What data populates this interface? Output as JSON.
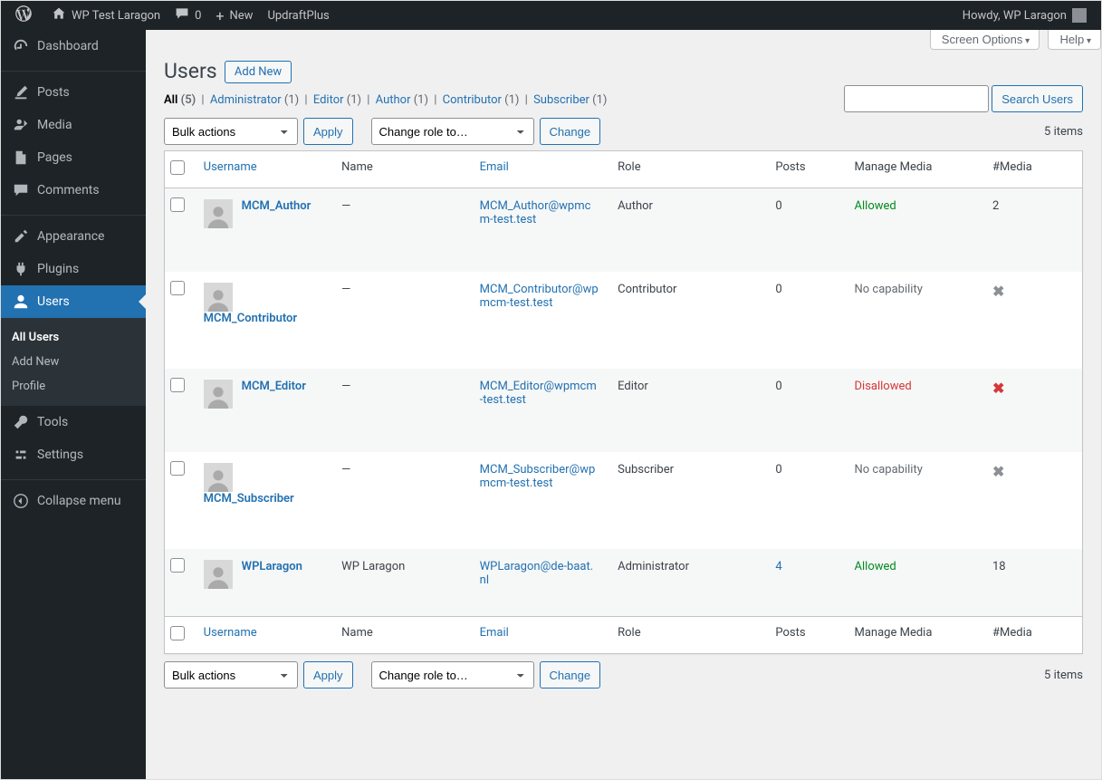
{
  "adminbar": {
    "site_name": "WP Test Laragon",
    "comments": "0",
    "new": "New",
    "updraft": "UpdraftPlus",
    "howdy": "Howdy, WP Laragon"
  },
  "sidebar": [
    {
      "icon": "dashboard",
      "label": "Dashboard"
    },
    {
      "sep": true
    },
    {
      "icon": "posts",
      "label": "Posts"
    },
    {
      "icon": "media",
      "label": "Media"
    },
    {
      "icon": "pages",
      "label": "Pages"
    },
    {
      "icon": "comments",
      "label": "Comments"
    },
    {
      "sep": true
    },
    {
      "icon": "appearance",
      "label": "Appearance"
    },
    {
      "icon": "plugins",
      "label": "Plugins"
    },
    {
      "icon": "users",
      "label": "Users",
      "current": true,
      "submenu": [
        {
          "label": "All Users",
          "current": true
        },
        {
          "label": "Add New"
        },
        {
          "label": "Profile"
        }
      ]
    },
    {
      "icon": "tools",
      "label": "Tools"
    },
    {
      "icon": "settings",
      "label": "Settings"
    },
    {
      "sep": true
    },
    {
      "icon": "collapse",
      "label": "Collapse menu"
    }
  ],
  "screen_links": {
    "screen_options": "Screen Options",
    "help": "Help"
  },
  "heading": "Users",
  "add_new": "Add New",
  "filters": [
    {
      "label": "All",
      "count": "(5)",
      "current": true
    },
    {
      "label": "Administrator",
      "count": "(1)"
    },
    {
      "label": "Editor",
      "count": "(1)"
    },
    {
      "label": "Author",
      "count": "(1)"
    },
    {
      "label": "Contributor",
      "count": "(1)"
    },
    {
      "label": "Subscriber",
      "count": "(1)"
    }
  ],
  "search_button": "Search Users",
  "bulk_label": "Bulk actions",
  "apply": "Apply",
  "change_role_label": "Change role to…",
  "change": "Change",
  "item_count": "5 items",
  "columns": {
    "username": "Username",
    "name": "Name",
    "email": "Email",
    "role": "Role",
    "posts": "Posts",
    "manage": "Manage Media",
    "media": "#Media"
  },
  "rows": [
    {
      "username": "MCM_Author",
      "name": "—",
      "email": "MCM_Author@wpmcm-test.test",
      "role": "Author",
      "posts": "0",
      "posts_link": false,
      "manage": "Allowed",
      "manage_cls": "allowed",
      "media": "2",
      "media_icon": ""
    },
    {
      "username": "MCM_Contributor",
      "username_below": true,
      "name": "—",
      "email": "MCM_Contributor@wpmcm-test.test",
      "role": "Contributor",
      "posts": "0",
      "posts_link": false,
      "manage": "No capability",
      "manage_cls": "nocap",
      "media": "",
      "media_icon": "gray"
    },
    {
      "username": "MCM_Editor",
      "name": "—",
      "email": "MCM_Editor@wpmcm-test.test",
      "role": "Editor",
      "posts": "0",
      "posts_link": false,
      "manage": "Disallowed",
      "manage_cls": "disallowed",
      "media": "",
      "media_icon": "red"
    },
    {
      "username": "MCM_Subscriber",
      "username_below": true,
      "name": "—",
      "email": "MCM_Subscriber@wpmcm-test.test",
      "role": "Subscriber",
      "posts": "0",
      "posts_link": false,
      "manage": "No capability",
      "manage_cls": "nocap",
      "media": "",
      "media_icon": "gray"
    },
    {
      "username": "WPLaragon",
      "name": "WP Laragon",
      "email": "WPLaragon@de-baat.nl",
      "role": "Administrator",
      "posts": "4",
      "posts_link": true,
      "manage": "Allowed",
      "manage_cls": "allowed",
      "media": "18",
      "media_icon": ""
    }
  ]
}
